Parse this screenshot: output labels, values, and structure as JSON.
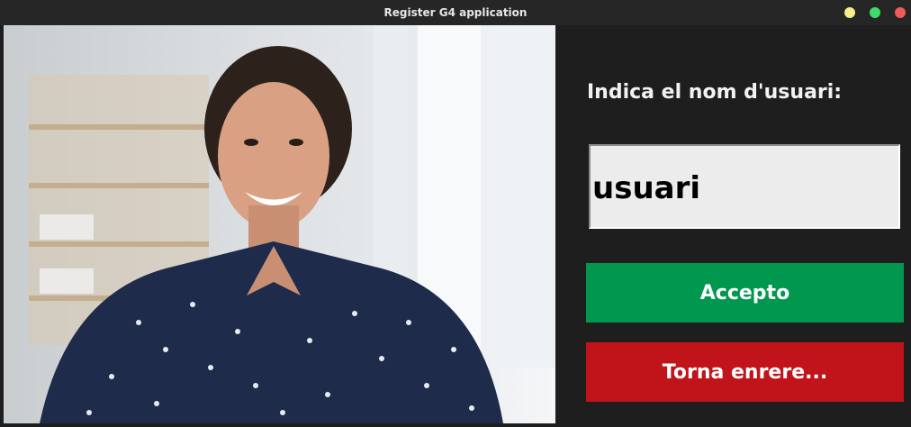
{
  "window": {
    "title": "Register G4 application",
    "controls": [
      "minimize-icon",
      "maximize-icon",
      "close-icon"
    ]
  },
  "form": {
    "prompt": "Indica el nom d'usuari:",
    "username_value": "usuari",
    "accept_label": "Accepto",
    "back_label": "Torna enrere..."
  },
  "colors": {
    "background": "#1e1e1e",
    "titlebar": "#262626",
    "accept_button": "#02974f",
    "back_button": "#c0141a",
    "input_background": "#ececec"
  }
}
